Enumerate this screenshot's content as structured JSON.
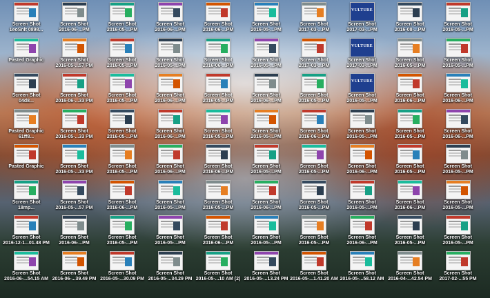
{
  "icons": [
    {
      "r": 0,
      "c": 0,
      "name": "Screen Shot",
      "date": "1eoSnlt 0898..."
    },
    {
      "r": 0,
      "c": 1,
      "name": "Screen Shot",
      "date": "2016-06-...PM"
    },
    {
      "r": 0,
      "c": 2,
      "name": "Screen Shot",
      "date": "2016-05-...PM"
    },
    {
      "r": 0,
      "c": 3,
      "name": "Screen Shot",
      "date": "2016-06-...PM"
    },
    {
      "r": 0,
      "c": 4,
      "name": "Screen Shot",
      "date": "2016-06-...PM"
    },
    {
      "r": 0,
      "c": 5,
      "name": "Screen Shot",
      "date": "2016-05-...PM"
    },
    {
      "r": 0,
      "c": 6,
      "name": "Screen Shot",
      "date": "2017-03-...PM"
    },
    {
      "r": 0,
      "c": 7,
      "name": "Screen Shot",
      "date": "2017-03-...PM"
    },
    {
      "r": 0,
      "c": 8,
      "name": "Screen Shot",
      "date": "2016-08-...PM"
    },
    {
      "r": 0,
      "c": 9,
      "name": "Screen Shot",
      "date": "2016-05-...PM"
    },
    {
      "r": 1,
      "c": 0,
      "name": "Pasted Graphic",
      "date": ""
    },
    {
      "r": 1,
      "c": 1,
      "name": "Screen Shot",
      "date": "2016-05-...57 PM"
    },
    {
      "r": 1,
      "c": 2,
      "name": "Screen Shot",
      "date": "2016-05-...PM"
    },
    {
      "r": 1,
      "c": 3,
      "name": "Screen Shot",
      "date": "2016-05-...PM"
    },
    {
      "r": 1,
      "c": 4,
      "name": "Screen Shot",
      "date": "2016-06-...PM"
    },
    {
      "r": 1,
      "c": 5,
      "name": "Screen Shot",
      "date": "2016-05-...PM"
    },
    {
      "r": 1,
      "c": 6,
      "name": "Screen Shot",
      "date": "2017-03-...PM"
    },
    {
      "r": 1,
      "c": 7,
      "name": "Screen Shot",
      "date": "2017-03-...PM"
    },
    {
      "r": 1,
      "c": 8,
      "name": "Screen Shot",
      "date": "2016-05-...PM"
    },
    {
      "r": 1,
      "c": 9,
      "name": "Screen Shot",
      "date": "2016-05-...PM"
    },
    {
      "r": 2,
      "c": 0,
      "name": "Screen Shot",
      "date": "04d8..."
    },
    {
      "r": 2,
      "c": 1,
      "name": "Screen Shot",
      "date": "2016-06-...33 PM"
    },
    {
      "r": 2,
      "c": 2,
      "name": "Screen Shot",
      "date": "2016-05-...PM"
    },
    {
      "r": 2,
      "c": 3,
      "name": "Screen Shot",
      "date": "2016-06-...PM"
    },
    {
      "r": 2,
      "c": 4,
      "name": "Screen Shot",
      "date": "2016-05-...PM"
    },
    {
      "r": 2,
      "c": 5,
      "name": "Screen Shot",
      "date": "2016-06-...PM"
    },
    {
      "r": 2,
      "c": 6,
      "name": "Screen Shot",
      "date": "2016-05-...PM"
    },
    {
      "r": 2,
      "c": 7,
      "name": "Screen Shot",
      "date": "2016-05-...PM"
    },
    {
      "r": 2,
      "c": 8,
      "name": "Screen Shot",
      "date": "2016-06-...PM"
    },
    {
      "r": 2,
      "c": 9,
      "name": "Screen Shot",
      "date": "2016-06-...PM"
    },
    {
      "r": 3,
      "c": 0,
      "name": "Pasted Graphic",
      "date": "61ff8..."
    },
    {
      "r": 3,
      "c": 1,
      "name": "Screen Shot",
      "date": "2016-05-...33 PM"
    },
    {
      "r": 3,
      "c": 2,
      "name": "Screen Shot",
      "date": "2016-05-...PM"
    },
    {
      "r": 3,
      "c": 3,
      "name": "Screen Shot",
      "date": "2016-06-...PM"
    },
    {
      "r": 3,
      "c": 4,
      "name": "Screen Shot",
      "date": "2016-05-...PM"
    },
    {
      "r": 3,
      "c": 5,
      "name": "Screen Shot",
      "date": "2016-05-...PM"
    },
    {
      "r": 3,
      "c": 6,
      "name": "Screen Shot",
      "date": "2016-06-...PM"
    },
    {
      "r": 3,
      "c": 7,
      "name": "Screen Shot",
      "date": "2016-05-...PM"
    },
    {
      "r": 3,
      "c": 8,
      "name": "Screen Shot",
      "date": "2016-05-...PM"
    },
    {
      "r": 3,
      "c": 9,
      "name": "Screen Shot",
      "date": "2016-06-...PM"
    },
    {
      "r": 4,
      "c": 0,
      "name": "Pasted Graphic",
      "date": ""
    },
    {
      "r": 4,
      "c": 1,
      "name": "Screen Shot",
      "date": "2016-05-...33 PM"
    },
    {
      "r": 4,
      "c": 2,
      "name": "Screen Shot",
      "date": "2016-05-...PM"
    },
    {
      "r": 4,
      "c": 3,
      "name": "Screen Shot",
      "date": "2016-06-...PM"
    },
    {
      "r": 4,
      "c": 4,
      "name": "Screen Shot",
      "date": "2016-06-...PM"
    },
    {
      "r": 4,
      "c": 5,
      "name": "Screen Shot",
      "date": "2016-05-...PM"
    },
    {
      "r": 4,
      "c": 6,
      "name": "Screen Shot",
      "date": "2016-05-...PM"
    },
    {
      "r": 4,
      "c": 7,
      "name": "Screen Shot",
      "date": "2016-06-...PM"
    },
    {
      "r": 4,
      "c": 8,
      "name": "Screen Shot",
      "date": "2016-05-...PM"
    },
    {
      "r": 4,
      "c": 9,
      "name": "Screen Shot",
      "date": "2016-05-...PM"
    },
    {
      "r": 5,
      "c": 0,
      "name": "Screen Shot",
      "date": "18mp..."
    },
    {
      "r": 5,
      "c": 1,
      "name": "Screen Shot",
      "date": "2016-05-...57 PM"
    },
    {
      "r": 5,
      "c": 2,
      "name": "Screen Shot",
      "date": "2016-06-...PM"
    },
    {
      "r": 5,
      "c": 3,
      "name": "Screen Shot",
      "date": "2016-05-...PM"
    },
    {
      "r": 5,
      "c": 4,
      "name": "Screen Shot",
      "date": "2016-05-...PM"
    },
    {
      "r": 5,
      "c": 5,
      "name": "Screen Shot",
      "date": "2016-06-...PM"
    },
    {
      "r": 5,
      "c": 6,
      "name": "Screen Shot",
      "date": "2016-05-...PM"
    },
    {
      "r": 5,
      "c": 7,
      "name": "Screen Shot",
      "date": "2016-05-...PM"
    },
    {
      "r": 5,
      "c": 8,
      "name": "Screen Shot",
      "date": "2016-06-...PM"
    },
    {
      "r": 5,
      "c": 9,
      "name": "Screen Shot",
      "date": "2016-05-...PM"
    },
    {
      "r": 6,
      "c": 0,
      "name": "Screen Shot",
      "date": "2016-12-1...01.48 PM"
    },
    {
      "r": 6,
      "c": 1,
      "name": "Screen Shot",
      "date": "2016-06-...PM"
    },
    {
      "r": 6,
      "c": 2,
      "name": "Screen Shot",
      "date": "2016-05-...PM"
    },
    {
      "r": 6,
      "c": 3,
      "name": "Screen Shot",
      "date": "2016-05-...PM"
    },
    {
      "r": 6,
      "c": 4,
      "name": "Screen Shot",
      "date": "2016-06-...PM"
    },
    {
      "r": 6,
      "c": 5,
      "name": "Screen Shot",
      "date": "2016-05-...PM"
    },
    {
      "r": 6,
      "c": 6,
      "name": "Screen Shot",
      "date": "2016-05-...PM"
    },
    {
      "r": 6,
      "c": 7,
      "name": "Screen Shot",
      "date": "2016-06-...PM"
    },
    {
      "r": 6,
      "c": 8,
      "name": "Screen Shot",
      "date": "2016-05-...PM"
    },
    {
      "r": 6,
      "c": 9,
      "name": "Screen Shot",
      "date": "2016-05-...PM"
    },
    {
      "r": 7,
      "c": 0,
      "name": "Screen Shot",
      "date": "2016-06-...54.15 AM"
    },
    {
      "r": 7,
      "c": 1,
      "name": "Screen Shot",
      "date": "2016-06-...39.49 PM"
    },
    {
      "r": 7,
      "c": 2,
      "name": "Screen Shot",
      "date": "2016-05-...30.09 PM"
    },
    {
      "r": 7,
      "c": 3,
      "name": "Screen Shot",
      "date": "2016-05-...34.29 PM"
    },
    {
      "r": 7,
      "c": 4,
      "name": "Screen Shot",
      "date": "2016-05-...10 AM (2)"
    },
    {
      "r": 7,
      "c": 5,
      "name": "Screen Shot",
      "date": "2016-05-...13.24 PM"
    },
    {
      "r": 7,
      "c": 6,
      "name": "Screen Shot",
      "date": "2016-05-...1.41.20 AM"
    },
    {
      "r": 7,
      "c": 7,
      "name": "Screen Shot",
      "date": "2016-05-...58.12 AM"
    },
    {
      "r": 7,
      "c": 8,
      "name": "Screen Shot",
      "date": "2016-04-...42.54 PM"
    },
    {
      "r": 7,
      "c": 9,
      "name": "Screen Shot",
      "date": "2017-02-...55 PM"
    }
  ],
  "thumb_colors": [
    "#c0392b",
    "#2c3e50",
    "#16a085",
    "#8e44ad",
    "#d35400",
    "#2980b9",
    "#7f8c8d",
    "#27ae60",
    "#34495e",
    "#c0392b",
    "#1abc9c",
    "#e67e22"
  ],
  "vulture_cells": [
    [
      0,
      7
    ],
    [
      1,
      7
    ],
    [
      2,
      7
    ]
  ],
  "vulture_text": "VULTURE"
}
